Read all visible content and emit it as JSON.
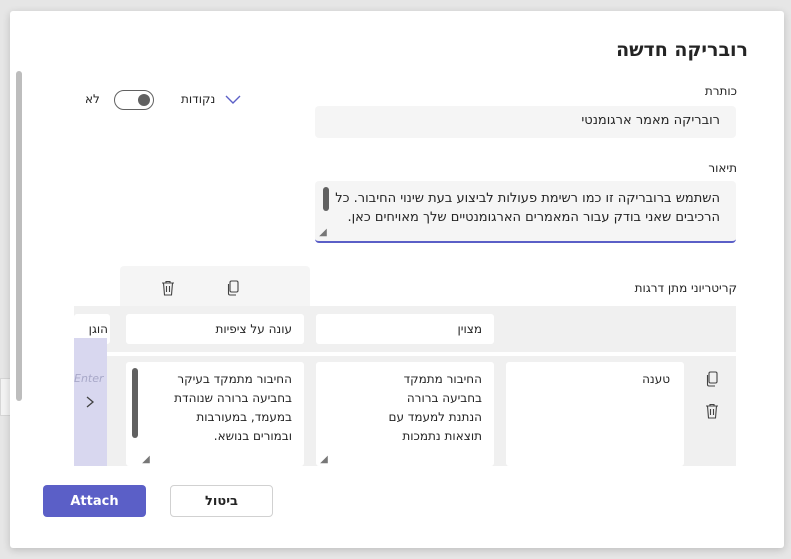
{
  "dialog": {
    "title": "רובריקה חדשה",
    "title_label": "כותרת",
    "title_value": "רובריקה מאמר ארגומנטי",
    "description_label": "תיאור",
    "description_value": "השתמש ברובריקה זו כמו רשימת פעולות לביצוע בעת שינוי החיבור. כל הרכיבים שאני בודק עבור המאמרים הארגומנטיים שלך מאויחים כאן.",
    "points_label": "נקודות",
    "toggle_label": "לא",
    "criteria_label": "קריטריוני מתן דרגות"
  },
  "levels": {
    "excellent": "מצוין",
    "meets": "עונה על ציפיות",
    "proficient_partial": "הוגן"
  },
  "criterion": {
    "name": "טענה",
    "excellent_text": "החיבור מתמקד בחביעה ברורה הנתנת למעמד עם תוצאות נתמכות",
    "meets_text": "החיבור מתמקד בעיקר בחביעה ברורה שנוהדת במעמד, במעורבות ובמורים בנושא.",
    "faded_placeholder": "Enter"
  },
  "footer": {
    "attach_label": "Attach",
    "cancel_label": "ביטול"
  },
  "colors": {
    "accent": "#5b5fc7",
    "nav_column": "#d8d7ef"
  }
}
